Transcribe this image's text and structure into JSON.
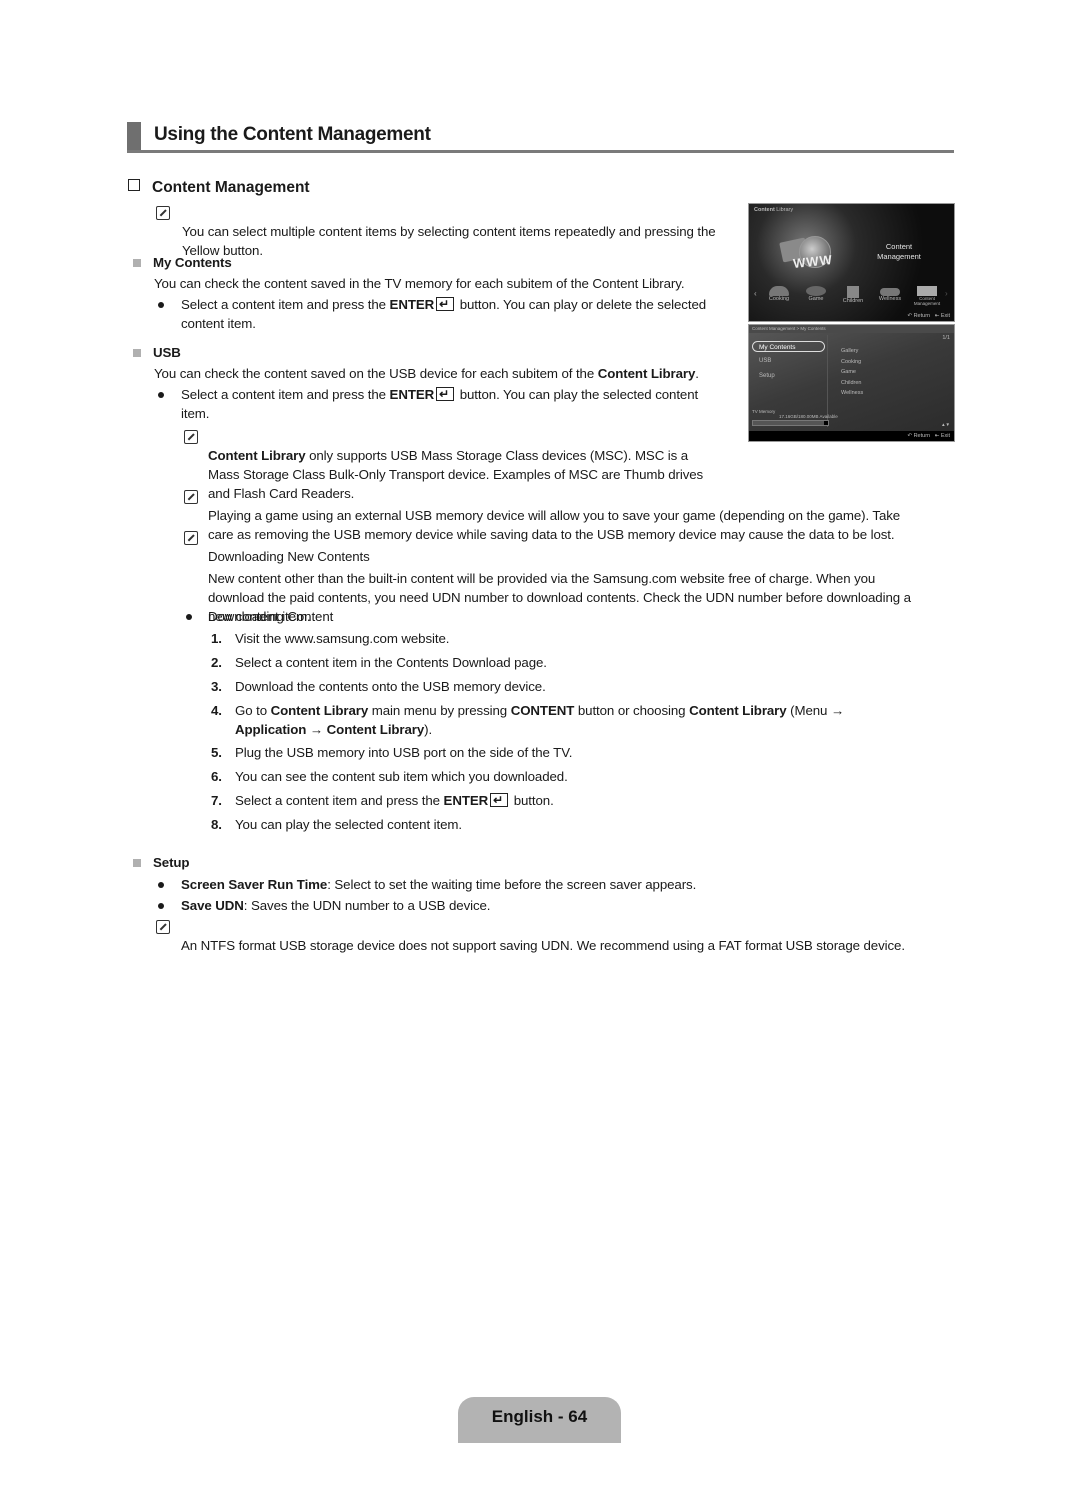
{
  "page": {
    "section_title": "Using the Content Management",
    "subsection_title": "Content Management",
    "footer": "English - 64"
  },
  "intro_note": "You can select multiple content items by selecting content items repeatedly and pressing the Yellow button.",
  "my_contents": {
    "heading": "My Contents",
    "desc": "You can check the content saved in the TV memory for each subitem of the Content Library.",
    "bullet_a": "Select a content item and press the ",
    "bullet_enter": "ENTER",
    "bullet_b": " button. You can play or delete the selected",
    "bullet_c": "content item."
  },
  "usb": {
    "heading": "USB",
    "desc_a": "You can check the content saved on the USB device for each subitem of the ",
    "desc_bold": "Content Library",
    "desc_b": ".",
    "bullet_a": "Select a content item and press the ",
    "bullet_enter": "ENTER",
    "bullet_b": " button. You can play the selected content",
    "bullet_c": "item.",
    "note1_bold": "Content Library",
    "note1_l1": " only supports USB Mass Storage Class devices (MSC). MSC is a",
    "note1_l2": "Mass Storage Class Bulk-Only Transport device. Examples of MSC are Thumb drives",
    "note1_l3": "and Flash Card Readers.",
    "note2_l1": "Playing a game using an external USB memory device will allow you to save your game (depending on the game). Take",
    "note2_l2": "care as removing the USB memory device while saving data to the USB memory device may cause the data to be lost.",
    "note3_title": "Downloading New Contents",
    "note3_l1": "New content other than the built-in content will be provided via the Samsung.com website free of charge. When you",
    "note3_l2": "download the paid contents, you need UDN number to download contents. Check the UDN number before downloading a",
    "note3_l3": "new content item.",
    "download_bullet": "Downloading Content",
    "steps": [
      {
        "n": "1.",
        "text": "Visit the www.samsung.com website."
      },
      {
        "n": "2.",
        "text": "Select a content item in the Contents Download page."
      },
      {
        "n": "3.",
        "text": "Download the contents onto the USB memory device."
      },
      {
        "n": "4.",
        "a": "Go to ",
        "b1": "Content Library",
        "c": " main menu by pressing ",
        "b2": "CONTENT",
        "d": " button or choosing ",
        "b3": "Content Library",
        "e": " (Menu →",
        "l2_b": "Application → Content Library",
        "l2_e": ")."
      },
      {
        "n": "5.",
        "text": "Plug the USB memory into USB port on the side of the TV."
      },
      {
        "n": "6.",
        "text": "You can see the content sub item which you downloaded."
      },
      {
        "n": "7.",
        "a": "Select a content item and press the ",
        "b": "ENTER",
        "c": " button."
      },
      {
        "n": "8.",
        "text": "You can play the selected content item."
      }
    ]
  },
  "setup": {
    "heading": "Setup",
    "b1_bold": "Screen Saver Run Time",
    "b1_text": ": Select to set the waiting time before the screen saver appears.",
    "b2_bold": "Save UDN",
    "b2_text": ": Saves the UDN number to a USB device.",
    "note": "An NTFS format USB storage device does not support saving UDN. We recommend using a FAT format USB storage device."
  },
  "tv_screen1": {
    "header_bold": "Content",
    "header_rest": " Library",
    "center_l1": "Content",
    "center_l2": "Management",
    "items": [
      "Cooking",
      "Game",
      "Children",
      "Wellness",
      "Content Management"
    ],
    "return": "Return",
    "exit": "Exit"
  },
  "tv_screen2": {
    "breadcrumb": "Content Management > My Contents",
    "page": "1/1",
    "menu": [
      "My Contents",
      "USB",
      "Setup"
    ],
    "list": [
      "Gallery",
      "Cooking",
      "Game",
      "Children",
      "Wellness"
    ],
    "memory_label": "TV Memory",
    "memory_value": "17.16GB/180.00MB Available",
    "memory_used_fraction": 0.95,
    "return": "Return",
    "exit": "Exit"
  }
}
